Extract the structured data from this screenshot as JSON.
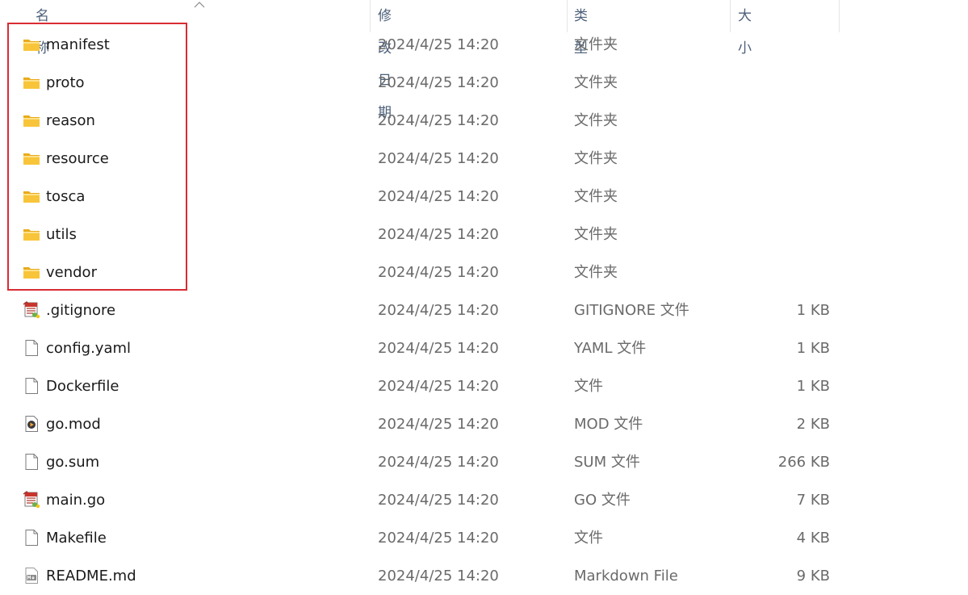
{
  "header": {
    "name": "名称",
    "date": "修改日期",
    "type": "类型",
    "size": "大小"
  },
  "rows": [
    {
      "name": "manifest",
      "date": "2024/4/25 14:20",
      "type": "文件夹",
      "size": "",
      "icon": "folder-icon"
    },
    {
      "name": "proto",
      "date": "2024/4/25 14:20",
      "type": "文件夹",
      "size": "",
      "icon": "folder-icon"
    },
    {
      "name": "reason",
      "date": "2024/4/25 14:20",
      "type": "文件夹",
      "size": "",
      "icon": "folder-icon"
    },
    {
      "name": "resource",
      "date": "2024/4/25 14:20",
      "type": "文件夹",
      "size": "",
      "icon": "folder-icon"
    },
    {
      "name": "tosca",
      "date": "2024/4/25 14:20",
      "type": "文件夹",
      "size": "",
      "icon": "folder-icon"
    },
    {
      "name": "utils",
      "date": "2024/4/25 14:20",
      "type": "文件夹",
      "size": "",
      "icon": "folder-icon"
    },
    {
      "name": "vendor",
      "date": "2024/4/25 14:20",
      "type": "文件夹",
      "size": "",
      "icon": "folder-icon"
    },
    {
      "name": ".gitignore",
      "date": "2024/4/25 14:20",
      "type": "GITIGNORE 文件",
      "size": "1 KB",
      "icon": "app-file-icon"
    },
    {
      "name": "config.yaml",
      "date": "2024/4/25 14:20",
      "type": "YAML 文件",
      "size": "1 KB",
      "icon": "blank-file-icon"
    },
    {
      "name": "Dockerfile",
      "date": "2024/4/25 14:20",
      "type": "文件",
      "size": "1 KB",
      "icon": "blank-file-icon"
    },
    {
      "name": "go.mod",
      "date": "2024/4/25 14:20",
      "type": "MOD 文件",
      "size": "2 KB",
      "icon": "media-file-icon"
    },
    {
      "name": "go.sum",
      "date": "2024/4/25 14:20",
      "type": "SUM 文件",
      "size": "266 KB",
      "icon": "blank-file-icon"
    },
    {
      "name": "main.go",
      "date": "2024/4/25 14:20",
      "type": "GO 文件",
      "size": "7 KB",
      "icon": "app-file-icon"
    },
    {
      "name": "Makefile",
      "date": "2024/4/25 14:20",
      "type": "文件",
      "size": "4 KB",
      "icon": "blank-file-icon"
    },
    {
      "name": "README.md",
      "date": "2024/4/25 14:20",
      "type": "Markdown File",
      "size": "9 KB",
      "icon": "markdown-file-icon"
    }
  ],
  "colors": {
    "highlight": "#d92c34",
    "folder": "#f8c53a",
    "header_text": "#4c607a"
  }
}
